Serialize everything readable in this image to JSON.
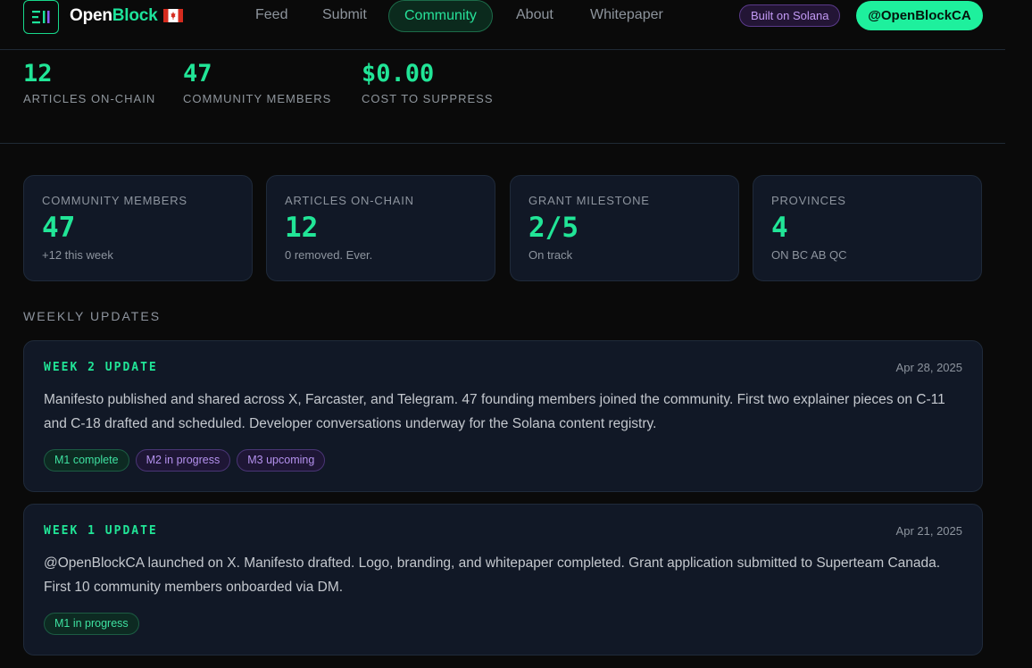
{
  "header": {
    "brand_main": "Open",
    "brand_accent": "Block",
    "brand_flag": "🇨🇦",
    "logo_icon": "openblock-logo-icon",
    "nav": [
      {
        "label": "Feed",
        "active": false
      },
      {
        "label": "Submit",
        "active": false
      },
      {
        "label": "Community",
        "active": true
      },
      {
        "label": "About",
        "active": false
      },
      {
        "label": "Whitepaper",
        "active": false
      }
    ],
    "solana_badge": "Built on Solana",
    "handle_button": "@OpenBlockCA"
  },
  "top_stats": [
    {
      "value": "12",
      "label": "ARTICLES ON-CHAIN"
    },
    {
      "value": "47",
      "label": "COMMUNITY MEMBERS"
    },
    {
      "value": "$0.00",
      "label": "COST TO SUPPRESS"
    }
  ],
  "cards": [
    {
      "label": "COMMUNITY MEMBERS",
      "value": "47",
      "sub": "+12 this week"
    },
    {
      "label": "ARTICLES ON-CHAIN",
      "value": "12",
      "sub": "0 removed. Ever."
    },
    {
      "label": "GRANT MILESTONE",
      "value": "2/5",
      "sub": "On track"
    },
    {
      "label": "PROVINCES",
      "value": "4",
      "sub": "ON BC AB QC"
    }
  ],
  "weekly_updates_title": "WEEKLY UPDATES",
  "updates": [
    {
      "title": "WEEK 2 UPDATE",
      "date": "Apr 28, 2025",
      "body": "Manifesto published and shared across X, Farcaster, and Telegram. 47 founding members joined the community. First two explainer pieces on C-11 and C-18 drafted and scheduled. Developer conversations underway for the Solana content registry.",
      "tags": [
        {
          "label": "M1 complete",
          "tone": "green"
        },
        {
          "label": "M2 in progress",
          "tone": "purple"
        },
        {
          "label": "M3 upcoming",
          "tone": "purple"
        }
      ]
    },
    {
      "title": "WEEK 1 UPDATE",
      "date": "Apr 21, 2025",
      "body": "@OpenBlockCA launched on X. Manifesto drafted. Logo, branding, and whitepaper completed. Grant application submitted to Superteam Canada. First 10 community members onboarded via DM.",
      "tags": [
        {
          "label": "M1 in progress",
          "tone": "green"
        }
      ]
    }
  ],
  "colors": {
    "accent": "#21e597",
    "background": "#0a0a0a",
    "card": "#111826",
    "purple": "#b491ee"
  }
}
